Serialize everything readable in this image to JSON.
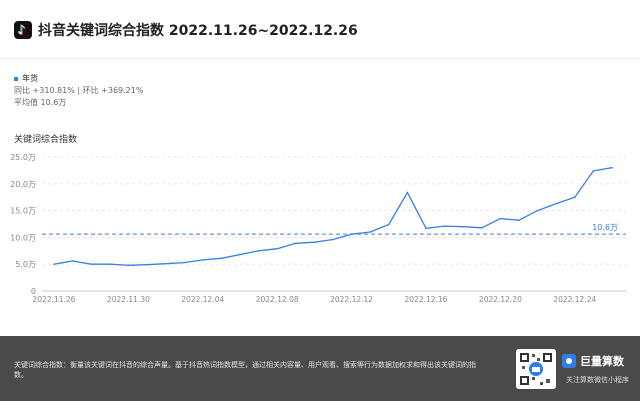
{
  "header": {
    "title": "抖音关键词综合指数 2022.11.26~2022.12.26",
    "logo_icon": "douyin-logo-icon"
  },
  "legend": {
    "series_name": "年货",
    "stats": "同比 +310.81% | 环比 +369.21%",
    "average": "平均值 10.6万"
  },
  "chart_data": {
    "type": "line",
    "title": "",
    "ylabel": "关键词综合指数",
    "xlabel": "",
    "ylim": [
      0,
      25
    ],
    "yticks": [
      0,
      5,
      10,
      15,
      20,
      25
    ],
    "ytick_labels": [
      "0",
      "5.0万",
      "10.0万",
      "15.0万",
      "20.0万",
      "25.0万"
    ],
    "x": [
      "2022.11.26",
      "2022.11.27",
      "2022.11.28",
      "2022.11.29",
      "2022.11.30",
      "2022.12.01",
      "2022.12.02",
      "2022.12.03",
      "2022.12.04",
      "2022.12.05",
      "2022.12.06",
      "2022.12.07",
      "2022.12.08",
      "2022.12.09",
      "2022.12.10",
      "2022.12.11",
      "2022.12.12",
      "2022.12.13",
      "2022.12.14",
      "2022.12.15",
      "2022.12.16",
      "2022.12.17",
      "2022.12.18",
      "2022.12.19",
      "2022.12.20",
      "2022.12.21",
      "2022.12.22",
      "2022.12.23",
      "2022.12.24",
      "2022.12.25",
      "2022.12.26"
    ],
    "xtick_labels": [
      "2022.11.26",
      "2022.11.30",
      "2022.12.04",
      "2022.12.08",
      "2022.12.12",
      "2022.12.16",
      "2022.12.20",
      "2022.12.24"
    ],
    "series": [
      {
        "name": "年货",
        "color": "#3a7fe6",
        "values": [
          5.0,
          5.6,
          5.0,
          5.0,
          4.8,
          4.9,
          5.1,
          5.3,
          5.8,
          6.1,
          6.8,
          7.5,
          7.9,
          8.9,
          9.1,
          9.6,
          10.6,
          11.0,
          12.4,
          18.4,
          11.7,
          12.1,
          12.0,
          11.8,
          13.5,
          13.2,
          15.0,
          16.3,
          17.5,
          22.4,
          23.0
        ]
      }
    ],
    "average_line": {
      "value": 10.6,
      "label": "10.6万",
      "color": "#3a7fe6"
    },
    "grid": true,
    "grid_color": "#e8e8e8"
  },
  "footer": {
    "description": "关键词综合指数：衡量该关键词在抖音的综合声量。基于抖音热词指数模型，通过相关内容量、用户观看、搜索等行为数据加权求和得出该关键词的指数。",
    "qr_icon": "qr-code-icon",
    "brand_name": "巨量算数",
    "brand_sub": "关注算数微信小程序"
  }
}
